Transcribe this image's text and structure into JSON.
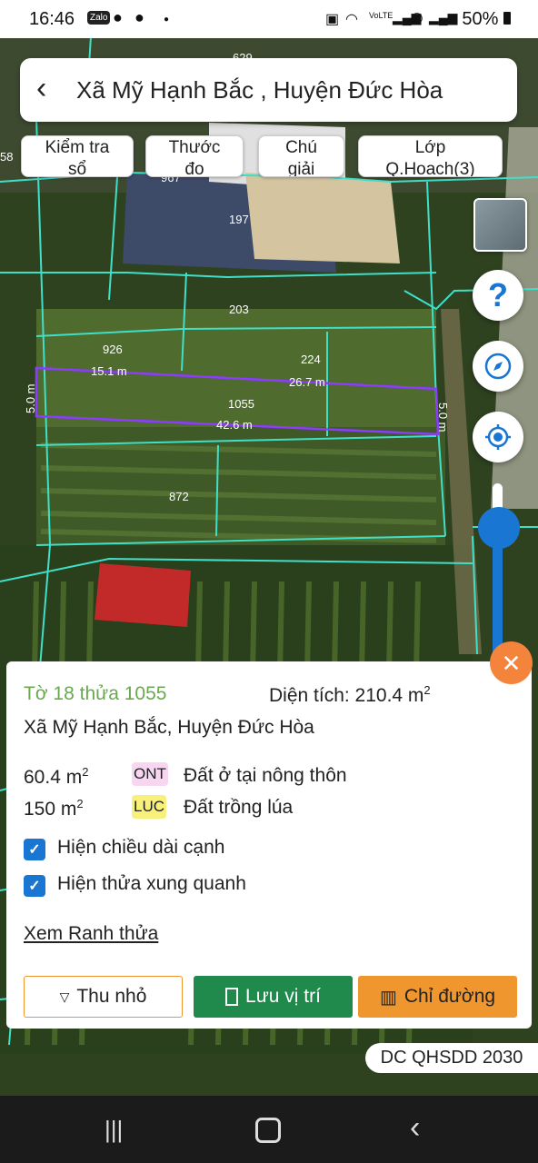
{
  "status_bar": {
    "time": "16:46",
    "notif_icons": [
      "zalo-icon",
      "chat-icon",
      "facebook-icon",
      "dot-icon"
    ],
    "system_icons": [
      "alarm-icon",
      "wifi-icon",
      "volte-icon",
      "signal-icon",
      "call-icon",
      "signal-icon"
    ],
    "battery": "50%"
  },
  "header": {
    "title": "Xã Mỹ Hạnh Bắc , Huyện Đức Hòa"
  },
  "toolbar": {
    "chips": [
      {
        "label": "Kiểm tra\nsổ"
      },
      {
        "label": "Thước\nđo"
      },
      {
        "label": "Chú\ngiải"
      },
      {
        "label": "Lớp\nQ.Hoach(3)"
      }
    ]
  },
  "map": {
    "parcel_labels": [
      "197",
      "203",
      "926",
      "224",
      "1055",
      "872",
      "967",
      "629",
      "58"
    ],
    "edge_labels": [
      "15.1 m",
      "26.7 m",
      "42.6 m",
      "5.0 m",
      "5.0 m"
    ]
  },
  "panel": {
    "parcel_id": "Tờ 18 thửa 1055",
    "area_label": "Diện tích: 210.4 m",
    "area_sup": "2",
    "address": "Xã Mỹ Hạnh Bắc, Huyện Đức Hòa",
    "land_uses": [
      {
        "area": "60.4 m",
        "sup": "2",
        "code": "ONT",
        "code_color": "#f8d5f0",
        "desc": "Đất ở tại nông thôn"
      },
      {
        "area": "150 m",
        "sup": "2",
        "code": "LUC",
        "code_color": "#f7f07a",
        "desc": "Đất trồng lúa"
      }
    ],
    "checkboxes": [
      {
        "label": "Hiện chiều dài cạnh",
        "checked": true
      },
      {
        "label": "Hiện thửa xung quanh",
        "checked": true
      }
    ],
    "link": "Xem Ranh thửa",
    "buttons": {
      "collapse": "Thu nhỏ",
      "save": "Lưu vị trí",
      "directions": "Chỉ đường"
    },
    "colors": {
      "save": "#1f8a4c",
      "directions": "#f0962e",
      "accent": "#1976d2"
    }
  },
  "map_overlay": {
    "layer_badge": "DC QHSDD 2030"
  }
}
